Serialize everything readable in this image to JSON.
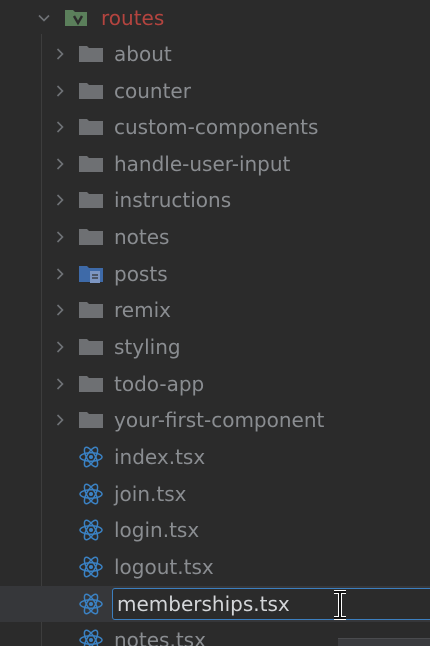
{
  "project_tree": {
    "root": {
      "label": "routes",
      "icon": "folder-open-icon",
      "expanded": true
    },
    "folders": [
      {
        "label": "about",
        "icon": "folder-icon"
      },
      {
        "label": "counter",
        "icon": "folder-icon"
      },
      {
        "label": "custom-components",
        "icon": "folder-icon"
      },
      {
        "label": "handle-user-input",
        "icon": "folder-icon"
      },
      {
        "label": "instructions",
        "icon": "folder-icon"
      },
      {
        "label": "notes",
        "icon": "folder-icon"
      },
      {
        "label": "posts",
        "icon": "folder-file-icon"
      },
      {
        "label": "remix",
        "icon": "folder-icon"
      },
      {
        "label": "styling",
        "icon": "folder-icon"
      },
      {
        "label": "todo-app",
        "icon": "folder-icon"
      },
      {
        "label": "your-first-component",
        "icon": "folder-icon"
      }
    ],
    "files": [
      {
        "label": "index.tsx",
        "icon": "react-icon"
      },
      {
        "label": "join.tsx",
        "icon": "react-icon"
      },
      {
        "label": "login.tsx",
        "icon": "react-icon"
      },
      {
        "label": "logout.tsx",
        "icon": "react-icon"
      },
      {
        "label": "memberships.tsx",
        "icon": "react-icon",
        "renaming": true
      },
      {
        "label": "notes.tsx",
        "icon": "react-icon"
      }
    ]
  },
  "colors": {
    "background": "#2b2b2b",
    "selected_row": "#36373a",
    "root_label": "#b4443f",
    "label": "#8a8d91",
    "folder": "#6e7073",
    "react": "#3b82c4",
    "rename_border": "#3c7fbf"
  }
}
